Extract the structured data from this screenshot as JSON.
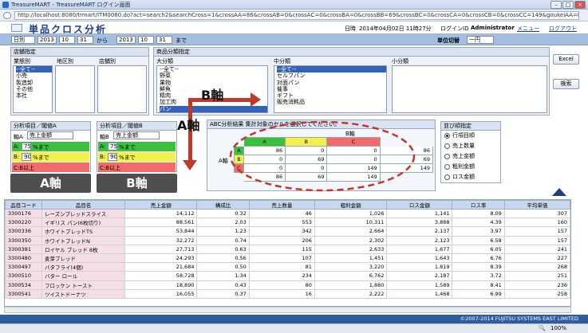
{
  "window": {
    "title": "TreasureMART - TreasureMART ログイン画面",
    "url": "http://localhost:8080/trmart/ITM0080.do?act=search2&searchCross=1&crossAA=86&crossAB=0&crossAC=0&crossBA=0&crossBB=69&crossBC=0&crossCA=0&crossCB=0&crossCC=149&goukeiAA=86&goukeiAB=0"
  },
  "header": {
    "title": "単品クロス分析",
    "date_label": "日時",
    "date_value": "2014年04月02日 11時27分",
    "login_label": "ログインID",
    "login_value": "Administrator",
    "menu_link": "メニュー",
    "logout_link": "ログアウト"
  },
  "toolbar": {
    "period_type": "日別",
    "from_year": "2013",
    "from_month": "10",
    "from_day": "31",
    "from_btn": "から",
    "to_year": "2013",
    "to_month": "10",
    "to_day": "31",
    "to_btn": "まで",
    "unit_label": "単位切替",
    "unit_value": "一円"
  },
  "store": {
    "heading": "店舗指定",
    "col1": "業態別",
    "col2": "地区別",
    "col3": "店舗別",
    "col1_items": [
      "--全て--",
      "小売",
      "製造卸",
      "その他",
      "本社"
    ]
  },
  "category": {
    "heading": "商品分類指定",
    "col1": "大分類",
    "col2": "中分類",
    "col3": "小分類",
    "large": [
      "--全て--",
      "野菜",
      "果物",
      "鮮魚",
      "精肉",
      "加工肉",
      "パン"
    ],
    "medium": [
      "--全て--",
      "セルフパン",
      "対面パン",
      "催事",
      "ギフト",
      "販売消耗品"
    ]
  },
  "buttons": {
    "excel": "Excel",
    "search": "検索"
  },
  "axisA": {
    "heading": "分析項目／閾値A",
    "axis_label": "軸A",
    "metric": "売上金額",
    "rowA_prefix": "A:",
    "rowA_value": "75",
    "rowA_suffix": "%まで",
    "rowB_prefix": "B:",
    "rowB_value": "90",
    "rowB_suffix": "%まで",
    "rowC": "C:B以上"
  },
  "axisB": {
    "heading": "分析項目／閾値B",
    "axis_label": "軸B",
    "metric": "売上金額",
    "rowA_prefix": "A:",
    "rowA_value": "75",
    "rowA_suffix": "%まで",
    "rowB_prefix": "B:",
    "rowB_value": "90",
    "rowB_suffix": "%まで",
    "rowC": "C:B以上"
  },
  "annotations": {
    "a_axis": "A軸",
    "b_axis": "B軸",
    "a_box": "A軸",
    "b_box": "B軸"
  },
  "matrix": {
    "title": "ABC分析結果  集計対象のセルを選択してください。",
    "b_header": "B軸",
    "a_header": "A軸",
    "cols": [
      "A",
      "B",
      "C"
    ],
    "rows": [
      {
        "label": "A",
        "values": [
          "86",
          "0",
          "0"
        ],
        "total": "86"
      },
      {
        "label": "B",
        "values": [
          "0",
          "69",
          "0"
        ],
        "total": "69"
      },
      {
        "label": "C",
        "values": [
          "0",
          "0",
          "149"
        ],
        "total": "149"
      }
    ],
    "totals": [
      "86",
      "69",
      "149"
    ]
  },
  "sort": {
    "heading": "並び順指定",
    "options": [
      "行項目順",
      "売上数量",
      "売上金額",
      "粗利金額",
      "ロス金額"
    ],
    "selected": 0
  },
  "grid": {
    "columns": [
      "品目コード",
      "品目名",
      "売上金額",
      "構成比",
      "売上数量",
      "粗利金額",
      "ロス金額",
      "ロス率",
      "平均単価"
    ],
    "rows": [
      [
        "3300176",
        "レーズンブレッドスライス",
        "14,112",
        "0.32",
        "46",
        "1,026",
        "1,141",
        "8.09",
        "307"
      ],
      [
        "3300220",
        "イギリス パン(6枚切り)",
        "88,561",
        "2.03",
        "553",
        "10,311",
        "3,888",
        "4.39",
        "160"
      ],
      [
        "3300336",
        "ホワイトブレッドTS",
        "53,844",
        "1.23",
        "342",
        "2,664",
        "2,137",
        "3.97",
        "157"
      ],
      [
        "3300350",
        "ホワイトブレッドN",
        "32,272",
        "0.74",
        "206",
        "2,302",
        "2,123",
        "6.58",
        "157"
      ],
      [
        "3300381",
        "ロイヤル ブレッド 8枚",
        "27,713",
        "0.63",
        "115",
        "2,633",
        "1,677",
        "6.05",
        "241"
      ],
      [
        "3300480",
        "麦芽ブレッド",
        "24,293",
        "0.56",
        "107",
        "1,451",
        "1,643",
        "6.76",
        "227"
      ],
      [
        "3300497",
        "バタフライ(4個)",
        "21,684",
        "0.50",
        "81",
        "3,220",
        "1,819",
        "8.39",
        "268"
      ],
      [
        "3300510",
        "バター ロール",
        "58,728",
        "1.34",
        "234",
        "6,762",
        "2,187",
        "3.72",
        "251"
      ],
      [
        "3300534",
        "フロッケン トースト",
        "18,890",
        "0.43",
        "80",
        "1,880",
        "1,589",
        "8.41",
        "236"
      ],
      [
        "3300541",
        "ツイストドーナツ",
        "16,055",
        "0.37",
        "16",
        "2,222",
        "1,468",
        "6.99",
        "258"
      ]
    ]
  },
  "footer": {
    "copyright": "©2007-2014 FUJITSU SYSTEMS EAST LIMITED"
  },
  "status": {
    "zoom": "100%"
  }
}
